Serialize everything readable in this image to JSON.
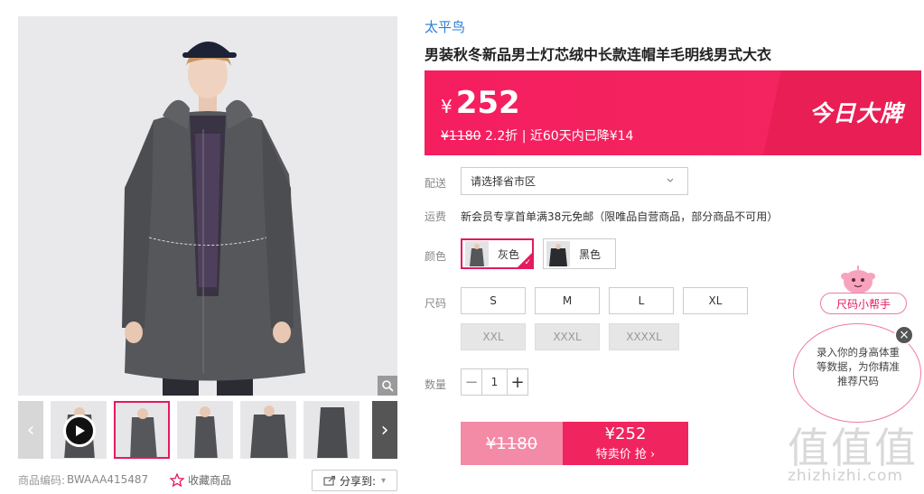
{
  "product": {
    "brand": "太平鸟",
    "title": "男装秋冬新品男士灯芯绒中长款连帽羊毛明线男式大衣"
  },
  "price": {
    "currency": "¥",
    "current": "252",
    "original": "¥1180",
    "discount": "2.2折",
    "history": "| 近60天内已降¥14",
    "badge": "今日大牌"
  },
  "delivery": {
    "label": "配送",
    "placeholder": "请选择省市区"
  },
  "shipping": {
    "label": "运费",
    "text": "新会员专享首单满38元免邮（限唯品自营商品，部分商品不可用）"
  },
  "color": {
    "label": "颜色",
    "options": [
      {
        "name": "灰色",
        "selected": true
      },
      {
        "name": "黑色",
        "selected": false
      }
    ]
  },
  "size": {
    "label": "尺码",
    "available": [
      "S",
      "M",
      "L",
      "XL"
    ],
    "unavailable": [
      "XXL",
      "XXXL",
      "XXXXL"
    ]
  },
  "quantity": {
    "label": "数量",
    "value": "1",
    "minus": "−",
    "plus": "+"
  },
  "buy": {
    "original": "¥1180",
    "price": "¥252",
    "action": "特卖价 抢"
  },
  "footer": {
    "code_label": "商品编码:",
    "code_value": "BWAAA415487",
    "favorite": "收藏商品",
    "share": "分享到:"
  },
  "helper": {
    "tag": "尺码小帮手",
    "text": "录入你的身高体重等数据，为你精准推荐尺码",
    "close": "×"
  },
  "watermark": {
    "main": "值值值",
    "url": "zhizhizhi.com"
  },
  "colors": {
    "accent": "#e5195f",
    "brand_link": "#2a7fd3"
  }
}
